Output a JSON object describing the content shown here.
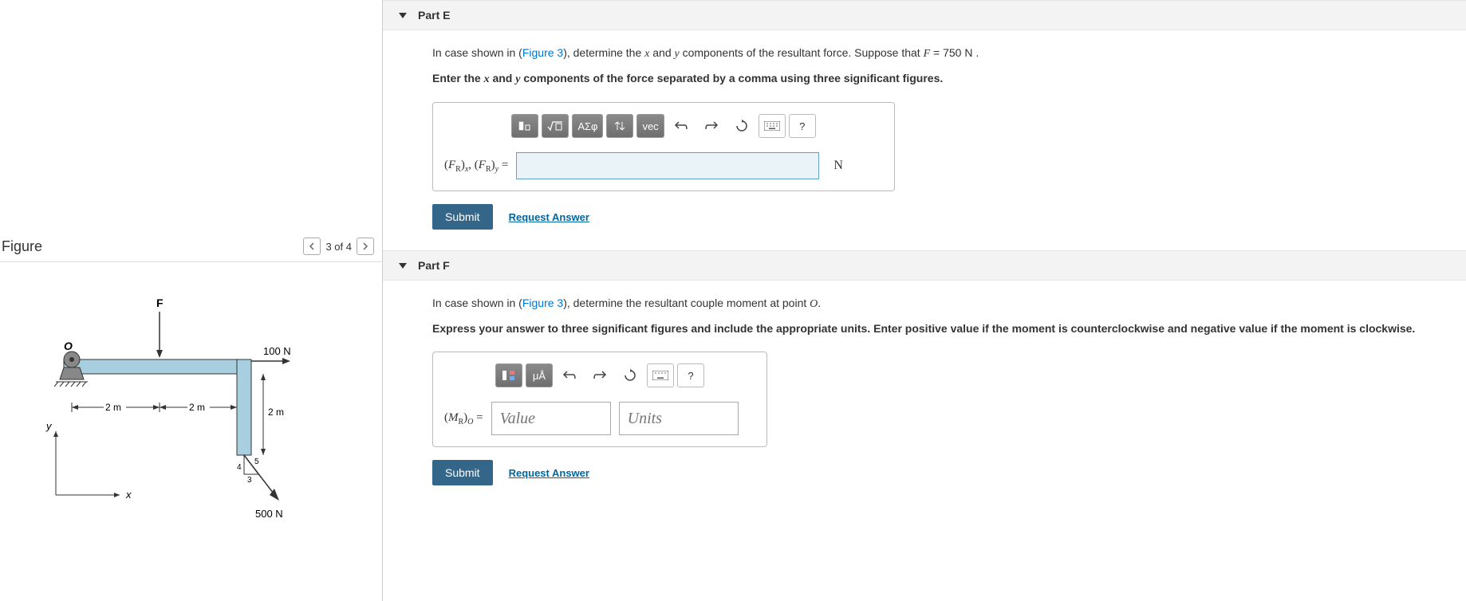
{
  "figure": {
    "title": "Figure",
    "nav_count": "3 of 4"
  },
  "diagram": {
    "F_label": "F",
    "O_label": "O",
    "force_100": "100 N",
    "force_500": "500 N",
    "dim_2m_a": "2 m",
    "dim_2m_b": "2 m",
    "dim_2m_c": "2 m",
    "axis_x": "x",
    "axis_y": "y",
    "tri_3": "3",
    "tri_4": "4",
    "tri_5": "5"
  },
  "partE": {
    "title": "Part E",
    "prompt_pre": "In case shown in (",
    "prompt_link": "Figure 3",
    "prompt_mid": "), determine the ",
    "prompt_and": " and ",
    "prompt_post": " components of the resultant force. Suppose that ",
    "prompt_eq": " = 750  N .",
    "instruction_pre": "Enter the ",
    "instruction_post": " components of the force separated by a comma using three significant figures.",
    "toolbar": {
      "greek": "ΑΣφ",
      "vec": "vec",
      "help": "?"
    },
    "answer_unit": "N",
    "submit": "Submit",
    "request": "Request Answer"
  },
  "partF": {
    "title": "Part F",
    "prompt_pre": "In case shown in (",
    "prompt_link": "Figure 3",
    "prompt_post": "), determine the resultant couple moment at point ",
    "prompt_end": ".",
    "instruction": "Express your answer to three significant figures and include the appropriate units. Enter positive value if the moment is counterclockwise and negative value if the moment is clockwise.",
    "toolbar": {
      "units": "μÅ",
      "help": "?"
    },
    "value_placeholder": "Value",
    "units_placeholder": "Units",
    "submit": "Submit",
    "request": "Request Answer"
  }
}
